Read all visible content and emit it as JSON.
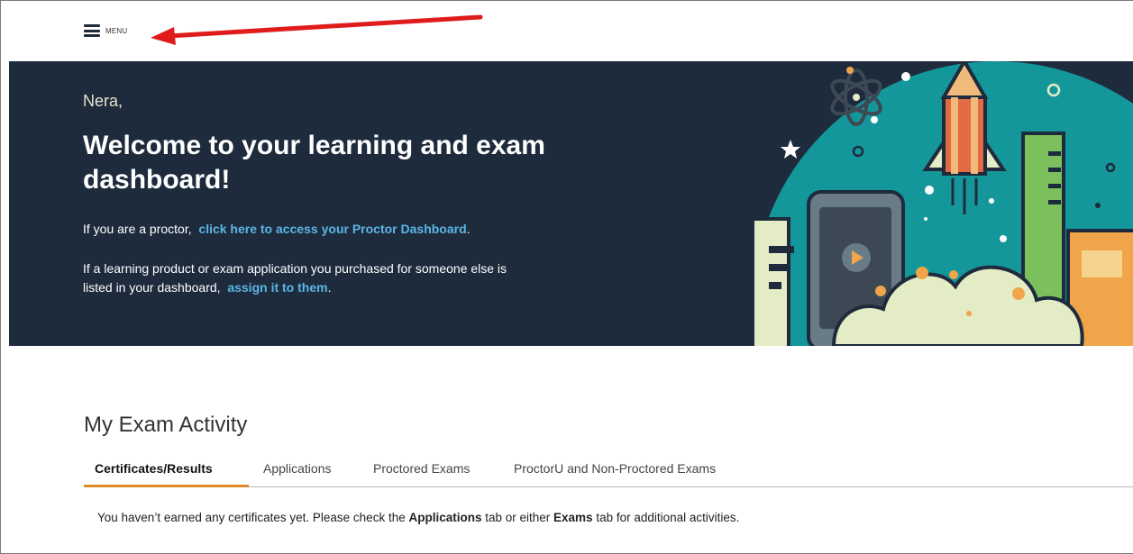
{
  "topbar": {
    "menu_label": "MENU",
    "icon": "hamburger-icon"
  },
  "hero": {
    "greeting": "Nera,",
    "title": "Welcome to your learning and exam dashboard!",
    "proctor_prefix": "If you are a proctor,",
    "proctor_link": "click here to access your Proctor Dashboard",
    "proctor_suffix": ".",
    "assign_text": "If a learning product or exam application you purchased for someone else is listed in your dashboard,",
    "assign_link": "assign it to them",
    "assign_suffix": ".",
    "background_color": "#1e2b3c",
    "link_color": "#5bb6e6"
  },
  "exam_activity": {
    "title": "My Exam Activity",
    "tabs": [
      {
        "label": "Certificates/Results",
        "active": true
      },
      {
        "label": "Applications",
        "active": false
      },
      {
        "label": "Proctored Exams",
        "active": false
      },
      {
        "label": "ProctorU and Non-Proctored Exams",
        "active": false
      }
    ],
    "active_tab_color": "#e08a2c",
    "message": {
      "part1": "You haven’t earned any certificates yet. Please check the ",
      "bold1": "Applications",
      "part2": " tab or either ",
      "bold2": "Exams",
      "part3": " tab for additional activities."
    }
  },
  "annotation": {
    "arrow_color": "#e01b1b"
  }
}
